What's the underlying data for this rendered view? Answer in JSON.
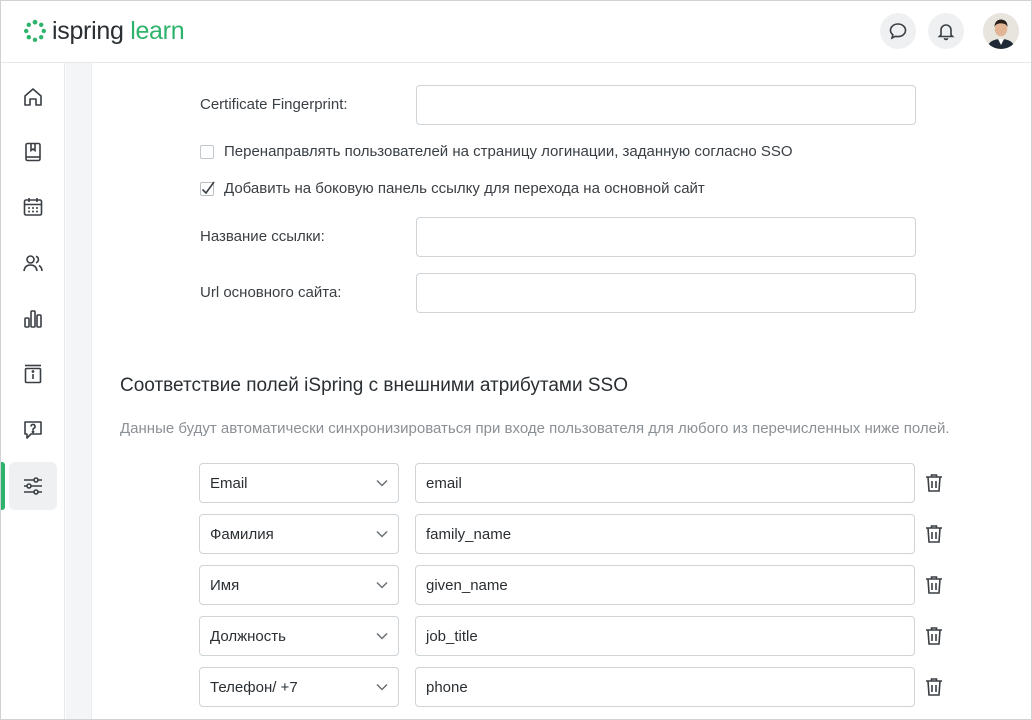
{
  "header": {
    "logo_part1": "ispring",
    "logo_part2": "learn",
    "brand_color": "#2db36b"
  },
  "sidebar": {
    "items": [
      {
        "icon": "home-icon",
        "name": "home",
        "active": false
      },
      {
        "icon": "book-icon",
        "name": "courses",
        "active": false
      },
      {
        "icon": "calendar-icon",
        "name": "calendar",
        "active": false
      },
      {
        "icon": "users-icon",
        "name": "users",
        "active": false
      },
      {
        "icon": "bar-chart-icon",
        "name": "reports",
        "active": false
      },
      {
        "icon": "info-board-icon",
        "name": "info",
        "active": false
      },
      {
        "icon": "question-chat-icon",
        "name": "help",
        "active": false
      },
      {
        "icon": "sliders-icon",
        "name": "settings",
        "active": true
      }
    ]
  },
  "form": {
    "fingerprint_label": "Certificate Fingerprint:",
    "fingerprint_value": "",
    "redirect_label": "Перенаправлять пользователей на страницу логинации, заданную согласно SSO",
    "redirect_checked": false,
    "sidebar_link_label": "Добавить на боковую панель ссылку для перехода на основной сайт",
    "sidebar_link_checked": true,
    "link_name_label": "Название ссылки:",
    "link_name_value": "",
    "site_url_label": "Url основного сайта:",
    "site_url_value": ""
  },
  "mapping": {
    "title": "Соответствие полей iSpring с внешними атрибутами SSO",
    "description": "Данные будут автоматически синхронизироваться при входе пользователя для любого из перечисленных ниже полей.",
    "rows": [
      {
        "field": "Email",
        "attribute": "email"
      },
      {
        "field": "Фамилия",
        "attribute": "family_name"
      },
      {
        "field": "Имя",
        "attribute": "given_name"
      },
      {
        "field": "Должность",
        "attribute": "job_title"
      },
      {
        "field": "Телефон/ +7",
        "attribute": "phone"
      }
    ]
  }
}
